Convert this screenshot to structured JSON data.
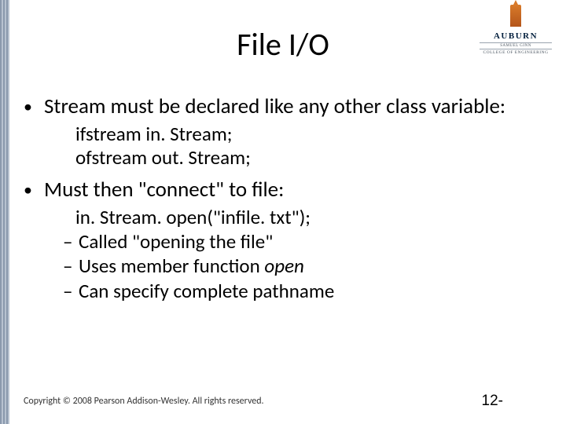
{
  "logo": {
    "university": "AUBURN",
    "subline": "SAMUEL GINN",
    "college": "COLLEGE OF ENGINEERING"
  },
  "title": "File I/O",
  "bullets": {
    "b1": "Stream must be declared like any other class variable:",
    "code1a": "ifstream in. Stream;",
    "code1b": "ofstream out. Stream;",
    "b2": "Must then \"connect\" to file:",
    "code2": "in. Stream. open(\"infile. txt\");",
    "s1": "Called \"opening the file\"",
    "s2a": "Uses member function ",
    "s2b": "open",
    "s3": "Can specify complete pathname"
  },
  "footer": {
    "copyright": "Copyright © 2008 Pearson Addison-Wesley. All rights reserved.",
    "page": "12-"
  }
}
